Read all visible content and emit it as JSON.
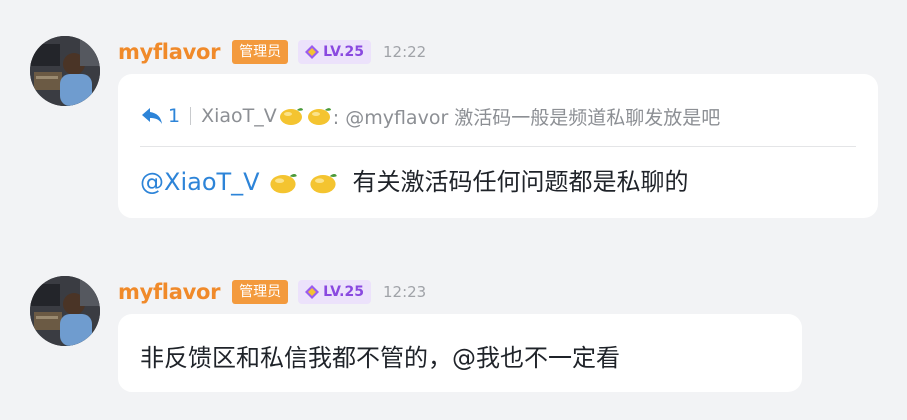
{
  "messages": [
    {
      "username": "myflavor",
      "role": "管理员",
      "level": "LV.25",
      "time": "12:22",
      "reply": {
        "count": "1",
        "author": "XiaoT_V",
        "quote": ": @myflavor 激活码一般是频道私聊发放是吧"
      },
      "mention": "@XiaoT_V",
      "text": "有关激活码任何问题都是私聊的"
    },
    {
      "username": "myflavor",
      "role": "管理员",
      "level": "LV.25",
      "time": "12:23",
      "text": "非反馈区和私信我都不管的，@我也不一定看"
    }
  ],
  "colors": {
    "background": "#f2f3f5",
    "username": "#f08a2a",
    "role_badge": "#f39a3d",
    "level_badge_bg": "#ece2fb",
    "level_badge_text": "#8a49e0",
    "mention": "#2d84d8"
  },
  "icons": [
    "avatar-photo",
    "level-gem-icon",
    "reply-arrow-icon",
    "lemon-emoji"
  ]
}
